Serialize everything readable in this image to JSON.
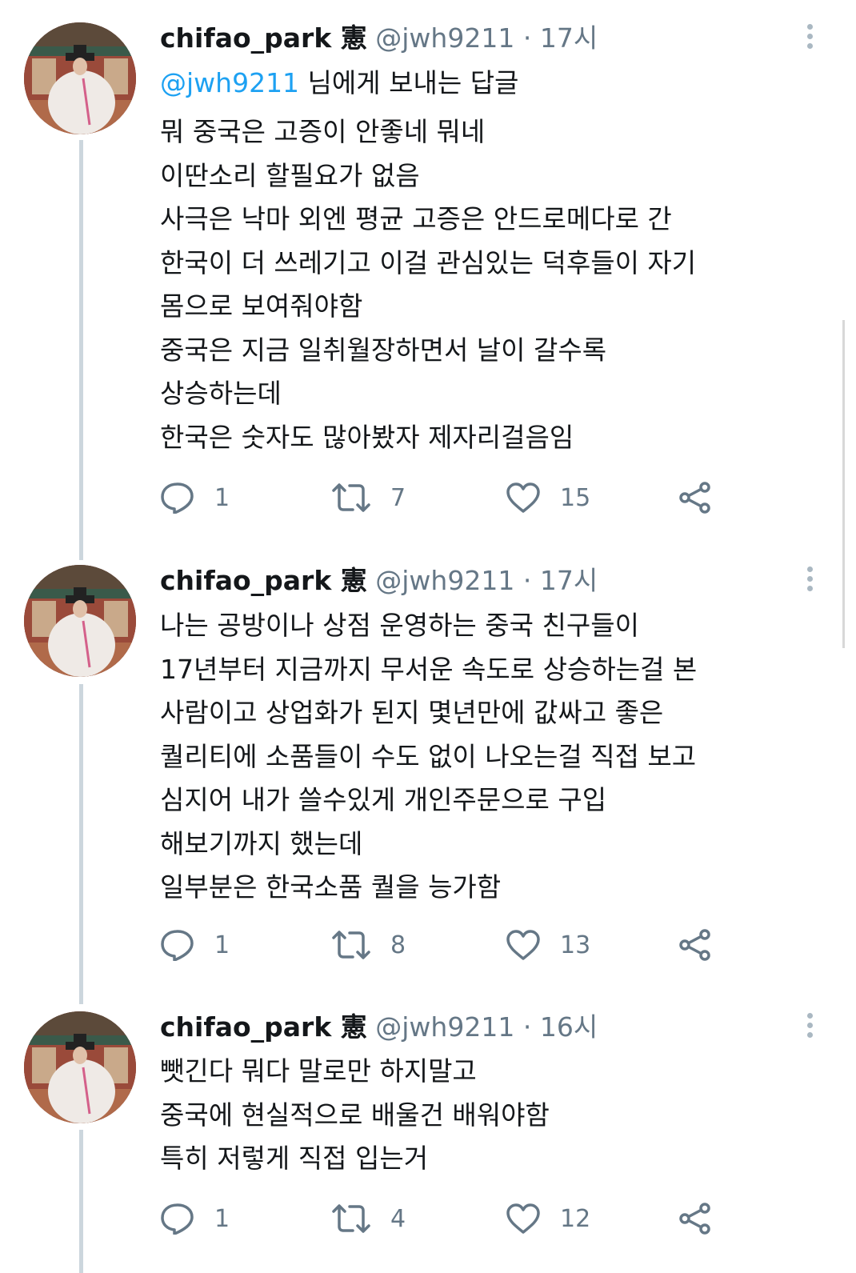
{
  "colors": {
    "accent": "#1da1f2",
    "secondary_text": "#657786",
    "thread_line": "#ccd6dd"
  },
  "tweets": [
    {
      "name": "chifao_park 憲",
      "handle": "@jwh9211",
      "dot": "·",
      "time": "17시",
      "reply_mention": "@jwh9211",
      "reply_suffix": " 님에게 보내는 답글",
      "lines": [
        "뭐 중국은 고증이 안좋네 뭐네",
        "이딴소리 할필요가 없음",
        "사극은 낙마 외엔 평균 고증은 안드로메다로 간",
        "한국이 더 쓰레기고 이걸 관심있는 덕후들이 자기",
        "몸으로 보여줘야함",
        "중국은 지금 일취월장하면서 날이 갈수록",
        "상승하는데",
        "한국은 숫자도 많아봤자 제자리걸음임"
      ],
      "replies": "1",
      "retweets": "7",
      "likes": "15"
    },
    {
      "name": "chifao_park 憲",
      "handle": "@jwh9211",
      "dot": "·",
      "time": "17시",
      "lines": [
        "나는 공방이나 상점 운영하는 중국 친구들이",
        "17년부터 지금까지 무서운 속도로 상승하는걸 본",
        "사람이고 상업화가 된지 몇년만에 값싸고 좋은",
        "퀄리티에 소품들이 수도 없이 나오는걸 직접 보고",
        "심지어 내가 쓸수있게 개인주문으로 구입",
        "해보기까지 했는데",
        "일부분은 한국소품 퀄을 능가함"
      ],
      "replies": "1",
      "retweets": "8",
      "likes": "13"
    },
    {
      "name": "chifao_park 憲",
      "handle": "@jwh9211",
      "dot": "·",
      "time": "16시",
      "lines": [
        "뺏긴다 뭐다 말로만 하지말고",
        "중국에 현실적으로 배울건 배워야함",
        "특히 저렇게 직접 입는거"
      ],
      "replies": "1",
      "retweets": "4",
      "likes": "12"
    }
  ],
  "icons": {
    "reply": "reply-icon",
    "retweet": "retweet-icon",
    "like": "heart-icon",
    "share": "share-icon",
    "more": "more-options-icon"
  }
}
